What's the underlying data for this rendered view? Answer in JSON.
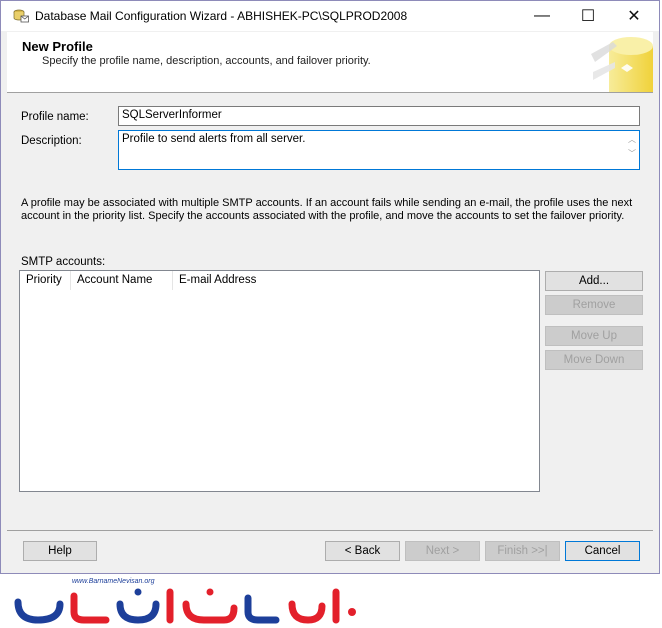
{
  "window": {
    "title": "Database Mail Configuration Wizard - ABHISHEK-PC\\SQLPROD2008",
    "minimize_glyph": "—",
    "maximize_glyph": "☐",
    "close_glyph": "✕"
  },
  "header": {
    "title": "New Profile",
    "subtitle": "Specify the profile name, description, accounts, and failover priority."
  },
  "form": {
    "profile_name_label": "Profile name:",
    "profile_name_value": "SQLServerInformer",
    "description_label": "Description:",
    "description_value": "Profile to send alerts from all server."
  },
  "info_text": "A profile may be associated with multiple SMTP accounts. If an account fails while sending an e-mail, the profile uses the next account in the priority list. Specify the accounts associated with the profile, and move the accounts to set the failover priority.",
  "smtp": {
    "label": "SMTP accounts:",
    "columns": [
      "Priority",
      "Account Name",
      "E-mail Address"
    ]
  },
  "side_buttons": {
    "add": "Add...",
    "remove": "Remove",
    "move_up": "Move Up",
    "move_down": "Move Down"
  },
  "footer_buttons": {
    "help": "Help",
    "back": "< Back",
    "next": "Next >",
    "finish": "Finish >>|",
    "cancel": "Cancel"
  },
  "watermark": {
    "url": "www.BarnameNevisan.org"
  },
  "colors": {
    "window_border": "#8e8bb9",
    "focus_blue": "#0078d7",
    "logo_red": "#e3202b",
    "logo_blue": "#1d3f9a"
  }
}
